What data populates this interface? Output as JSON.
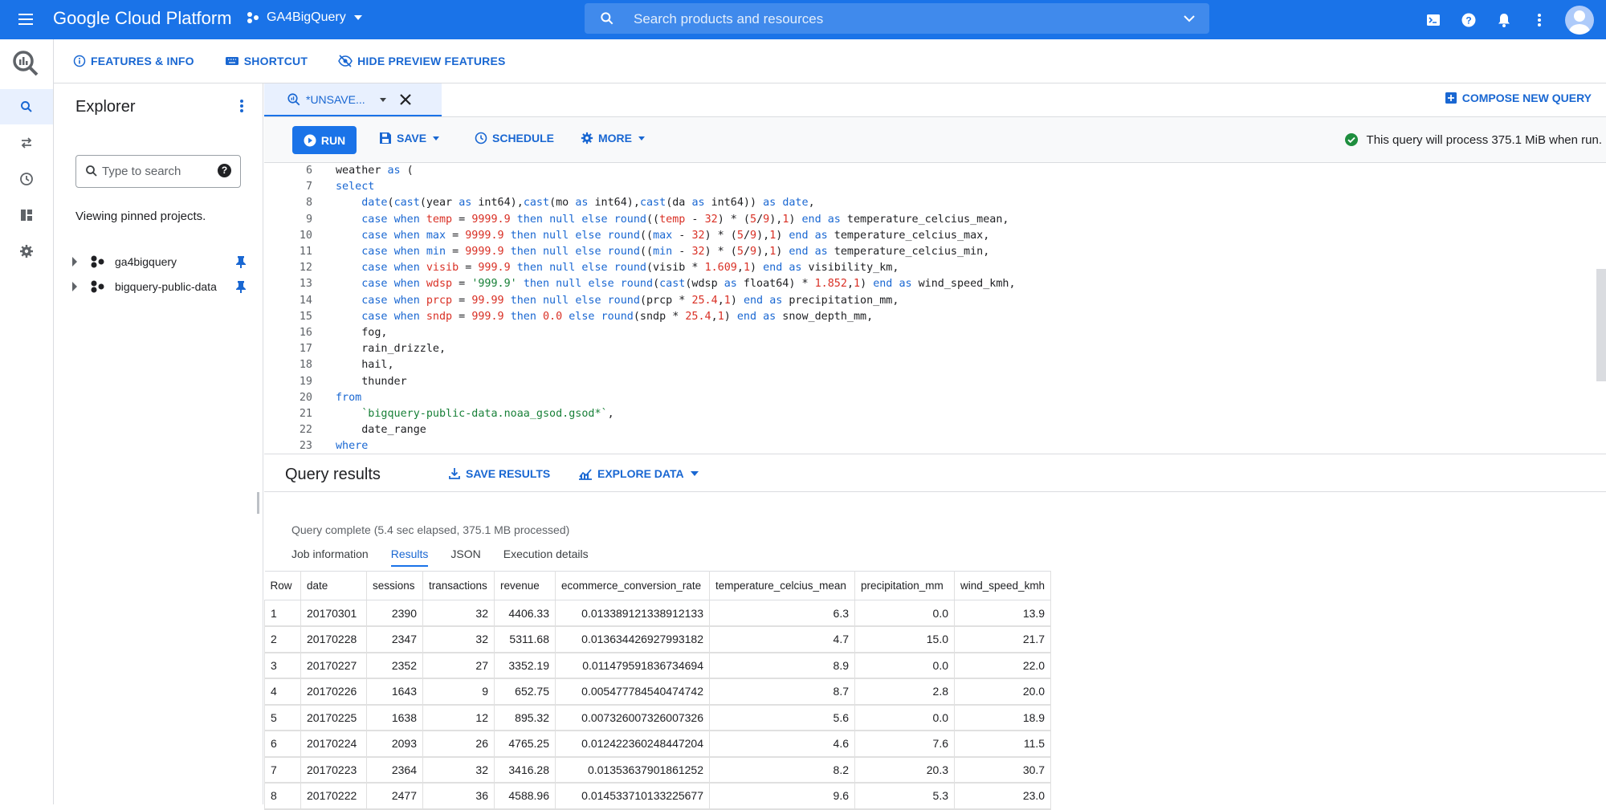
{
  "topbar": {
    "brand": "Google Cloud Platform",
    "project": "GA4BigQuery",
    "search_placeholder": "Search products and resources"
  },
  "subbar": {
    "features": "FEATURES & INFO",
    "shortcut": "SHORTCUT",
    "hide_preview": "HIDE PREVIEW FEATURES"
  },
  "explorer": {
    "title": "Explorer",
    "search_placeholder": "Type to search",
    "pinned_text": "Viewing pinned projects.",
    "projects": [
      "ga4bigquery",
      "bigquery-public-data"
    ]
  },
  "editor": {
    "tab_label": "*UNSAVE...",
    "compose": "COMPOSE NEW QUERY",
    "run": "RUN",
    "save": "SAVE",
    "schedule": "SCHEDULE",
    "more": "MORE",
    "status": "This query will process 375.1 MiB when run.",
    "lines": [
      {
        "n": "6",
        "html": "weather <span class='k'>as</span> ("
      },
      {
        "n": "7",
        "html": "<span class='k'>select</span>"
      },
      {
        "n": "8",
        "html": "    <span class='k'>date</span>(<span class='k'>cast</span>(year <span class='k'>as</span> int64),<span class='k'>cast</span>(mo <span class='k'>as</span> int64),<span class='k'>cast</span>(da <span class='k'>as</span> int64)) <span class='k'>as</span> <span class='k'>date</span>,"
      },
      {
        "n": "9",
        "html": "    <span class='k'>case</span> <span class='k'>when</span> <span class='n'>temp</span> = <span class='n'>9999.9</span> <span class='k'>then</span> <span class='k'>null</span> <span class='k'>else</span> <span class='k'>round</span>((<span class='n'>temp</span> - <span class='n'>32</span>) * (<span class='n'>5</span>/<span class='n'>9</span>),<span class='n'>1</span>) <span class='k'>end</span> <span class='k'>as</span> temperature_celcius_mean,"
      },
      {
        "n": "10",
        "html": "    <span class='k'>case</span> <span class='k'>when</span> <span class='k'>max</span> = <span class='n'>9999.9</span> <span class='k'>then</span> <span class='k'>null</span> <span class='k'>else</span> <span class='k'>round</span>((<span class='k'>max</span> - <span class='n'>32</span>) * (<span class='n'>5</span>/<span class='n'>9</span>),<span class='n'>1</span>) <span class='k'>end</span> <span class='k'>as</span> temperature_celcius_max,"
      },
      {
        "n": "11",
        "html": "    <span class='k'>case</span> <span class='k'>when</span> <span class='k'>min</span> = <span class='n'>9999.9</span> <span class='k'>then</span> <span class='k'>null</span> <span class='k'>else</span> <span class='k'>round</span>((<span class='k'>min</span> - <span class='n'>32</span>) * (<span class='n'>5</span>/<span class='n'>9</span>),<span class='n'>1</span>) <span class='k'>end</span> <span class='k'>as</span> temperature_celcius_min,"
      },
      {
        "n": "12",
        "html": "    <span class='k'>case</span> <span class='k'>when</span> <span class='n'>visib</span> = <span class='n'>999.9</span> <span class='k'>then</span> <span class='k'>null</span> <span class='k'>else</span> <span class='k'>round</span>(visib * <span class='n'>1.609</span>,<span class='n'>1</span>) <span class='k'>end</span> <span class='k'>as</span> visibility_km,"
      },
      {
        "n": "13",
        "html": "    <span class='k'>case</span> <span class='k'>when</span> <span class='n'>wdsp</span> = <span class='s'>'999.9'</span> <span class='k'>then</span> <span class='k'>null</span> <span class='k'>else</span> <span class='k'>round</span>(<span class='k'>cast</span>(wdsp <span class='k'>as</span> float64) * <span class='n'>1.852</span>,<span class='n'>1</span>) <span class='k'>end</span> <span class='k'>as</span> wind_speed_kmh,"
      },
      {
        "n": "14",
        "html": "    <span class='k'>case</span> <span class='k'>when</span> <span class='n'>prcp</span> = <span class='n'>99.99</span> <span class='k'>then</span> <span class='k'>null</span> <span class='k'>else</span> <span class='k'>round</span>(prcp * <span class='n'>25.4</span>,<span class='n'>1</span>) <span class='k'>end</span> <span class='k'>as</span> precipitation_mm,"
      },
      {
        "n": "15",
        "html": "    <span class='k'>case</span> <span class='k'>when</span> <span class='n'>sndp</span> = <span class='n'>999.9</span> <span class='k'>then</span> <span class='n'>0.0</span> <span class='k'>else</span> <span class='k'>round</span>(sndp * <span class='n'>25.4</span>,<span class='n'>1</span>) <span class='k'>end</span> <span class='k'>as</span> snow_depth_mm,"
      },
      {
        "n": "16",
        "html": "    fog,"
      },
      {
        "n": "17",
        "html": "    rain_drizzle,"
      },
      {
        "n": "18",
        "html": "    hail,"
      },
      {
        "n": "19",
        "html": "    thunder"
      },
      {
        "n": "20",
        "html": "<span class='k'>from</span>"
      },
      {
        "n": "21",
        "html": "    <span class='s'>`bigquery-public-data.noaa_gsod.gsod*`</span>,"
      },
      {
        "n": "22",
        "html": "    date_range"
      },
      {
        "n": "23",
        "html": "<span class='k'>where</span>"
      }
    ]
  },
  "results": {
    "title": "Query results",
    "save_results": "SAVE RESULTS",
    "explore_data": "EXPLORE DATA",
    "complete_text": "Query complete (5.4 sec elapsed, 375.1 MB processed)",
    "tabs": [
      "Job information",
      "Results",
      "JSON",
      "Execution details"
    ],
    "active_tab": "Results",
    "columns": [
      "Row",
      "date",
      "sessions",
      "transactions",
      "revenue",
      "ecommerce_conversion_rate",
      "temperature_celcius_mean",
      "precipitation_mm",
      "wind_speed_kmh"
    ],
    "rows": [
      [
        "1",
        "20170301",
        "2390",
        "32",
        "4406.33",
        "0.013389121338912133",
        "6.3",
        "0.0",
        "13.9"
      ],
      [
        "2",
        "20170228",
        "2347",
        "32",
        "5311.68",
        "0.013634426927993182",
        "4.7",
        "15.0",
        "21.7"
      ],
      [
        "3",
        "20170227",
        "2352",
        "27",
        "3352.19",
        "0.011479591836734694",
        "8.9",
        "0.0",
        "22.0"
      ],
      [
        "4",
        "20170226",
        "1643",
        "9",
        "652.75",
        "0.005477784540474742",
        "8.7",
        "2.8",
        "20.0"
      ],
      [
        "5",
        "20170225",
        "1638",
        "12",
        "895.32",
        "0.007326007326007326",
        "5.6",
        "0.0",
        "18.9"
      ],
      [
        "6",
        "20170224",
        "2093",
        "26",
        "4765.25",
        "0.012422360248447204",
        "4.6",
        "7.6",
        "11.5"
      ],
      [
        "7",
        "20170223",
        "2364",
        "32",
        "3416.28",
        "0.01353637901861252",
        "8.2",
        "20.3",
        "30.7"
      ],
      [
        "8",
        "20170222",
        "2477",
        "36",
        "4588.96",
        "0.014533710133225677",
        "9.6",
        "5.3",
        "23.0"
      ]
    ]
  },
  "colors": {
    "brand_blue": "#1a73e8",
    "link_blue": "#1967d2",
    "success_green": "#1e8e3e"
  }
}
